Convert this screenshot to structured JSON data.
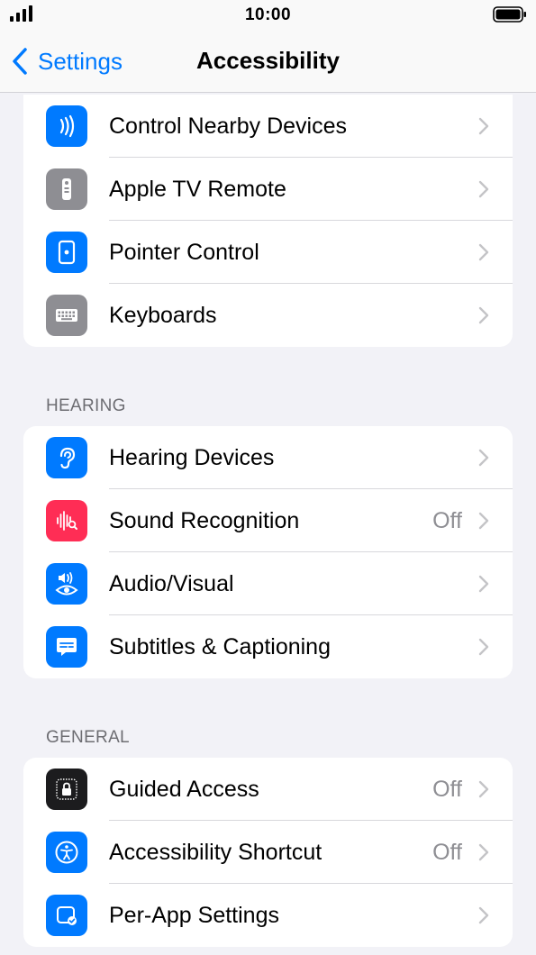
{
  "status_bar": {
    "time": "10:00"
  },
  "nav": {
    "back_label": "Settings",
    "title": "Accessibility"
  },
  "groups": [
    {
      "header": "",
      "rows": [
        {
          "label": "Control Nearby Devices",
          "value": "",
          "icon": "control-nearby-devices-icon",
          "color": "#007aff"
        },
        {
          "label": "Apple TV Remote",
          "value": "",
          "icon": "apple-tv-remote-icon",
          "color": "#8e8e93"
        },
        {
          "label": "Pointer Control",
          "value": "",
          "icon": "pointer-control-icon",
          "color": "#007aff"
        },
        {
          "label": "Keyboards",
          "value": "",
          "icon": "keyboard-icon",
          "color": "#8e8e93"
        }
      ]
    },
    {
      "header": "HEARING",
      "rows": [
        {
          "label": "Hearing Devices",
          "value": "",
          "icon": "ear-icon",
          "color": "#007aff"
        },
        {
          "label": "Sound Recognition",
          "value": "Off",
          "icon": "sound-recognition-icon",
          "color": "#ff2d55"
        },
        {
          "label": "Audio/Visual",
          "value": "",
          "icon": "audio-visual-icon",
          "color": "#007aff"
        },
        {
          "label": "Subtitles & Captioning",
          "value": "",
          "icon": "subtitles-icon",
          "color": "#007aff"
        }
      ]
    },
    {
      "header": "GENERAL",
      "rows": [
        {
          "label": "Guided Access",
          "value": "Off",
          "icon": "guided-access-lock-icon",
          "color": "#1c1c1e"
        },
        {
          "label": "Accessibility Shortcut",
          "value": "Off",
          "icon": "accessibility-shortcut-icon",
          "color": "#007aff"
        },
        {
          "label": "Per-App Settings",
          "value": "",
          "icon": "per-app-settings-icon",
          "color": "#007aff"
        }
      ]
    }
  ]
}
